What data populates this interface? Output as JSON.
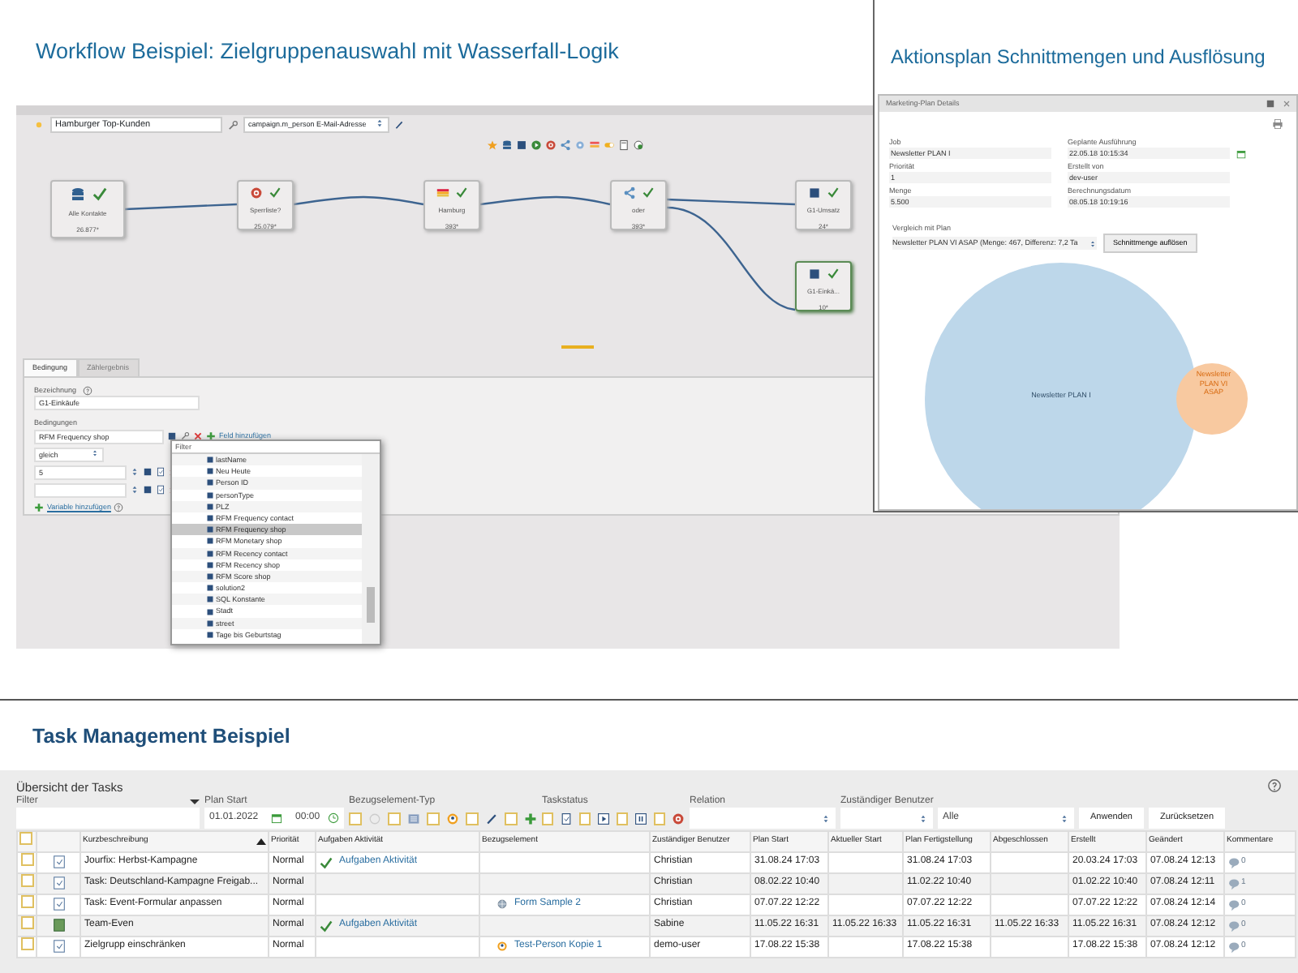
{
  "workflow": {
    "heading": "Workflow Beispiel: Zielgruppenauswahl mit Wasserfall-Logik",
    "name_field": "Hamburger Top-Kunden",
    "attribute_select": "campaign.m_person E-Mail-Adresse",
    "nodes": [
      {
        "label": "Alle Kontakte",
        "count": "26.877*",
        "kind": "database",
        "selected": false
      },
      {
        "label": "Sperrliste?",
        "count": "25.079*",
        "kind": "stop",
        "selected": false
      },
      {
        "label": "Hamburg",
        "count": "393*",
        "kind": "stripes",
        "selected": false
      },
      {
        "label": "oder",
        "count": "393*",
        "kind": "share",
        "selected": false
      },
      {
        "label": "G1-Umsatz",
        "count": "24*",
        "kind": "square",
        "selected": false
      },
      {
        "label": "G1-Einkä...",
        "count": "10*",
        "kind": "square",
        "selected": true
      }
    ],
    "tabs": [
      {
        "label": "Bedingung",
        "selected": true
      },
      {
        "label": "Zählergebnis",
        "selected": false
      }
    ],
    "form": {
      "name_label": "Bezeichnung",
      "name_value": "G1-Einkäufe",
      "conditions_label": "Bedingungen",
      "condition_field": "RFM Frequency shop",
      "add_field_link": "Feld hinzufügen",
      "operator": "gleich",
      "values": [
        {
          "kind": "filled",
          "value": "5"
        },
        {
          "kind": "blank"
        }
      ],
      "add_variable_link": "Variable hinzufügen"
    },
    "dropdown": {
      "placeholder": "Filter",
      "items": [
        {
          "label": "lastName",
          "selected": false
        },
        {
          "label": "Neu Heute",
          "selected": false
        },
        {
          "label": "Person ID",
          "selected": false
        },
        {
          "label": "personType",
          "selected": false
        },
        {
          "label": "PLZ",
          "selected": false
        },
        {
          "label": "RFM Frequency contact",
          "selected": false
        },
        {
          "label": "RFM Frequency shop",
          "selected": true
        },
        {
          "label": "RFM Monetary shop",
          "selected": false
        },
        {
          "label": "RFM Recency contact",
          "selected": false
        },
        {
          "label": "RFM Recency shop",
          "selected": false
        },
        {
          "label": "RFM Score shop",
          "selected": false
        },
        {
          "label": "solution2",
          "selected": false
        },
        {
          "label": "SQL Konstante",
          "selected": false
        },
        {
          "label": "Stadt",
          "selected": false
        },
        {
          "label": "street",
          "selected": false
        },
        {
          "label": "Tage bis Geburtstag",
          "selected": false
        }
      ]
    }
  },
  "action_plan": {
    "heading": "Aktionsplan Schnittmengen und Ausflösung",
    "window_title": "Marketing-Plan Details",
    "fields": [
      {
        "label": "Job",
        "value": "Newsletter PLAN I"
      },
      {
        "label": "Geplante Ausführung",
        "value": "22.05.18 10:15:34"
      },
      {
        "label": "Priorität",
        "value": "1"
      },
      {
        "label": "Erstellt von",
        "value": "dev-user"
      },
      {
        "label": "Menge",
        "value": "5.500"
      },
      {
        "label": "Berechnungsdatum",
        "value": "08.05.18 10:19:16"
      }
    ],
    "compare_label": "Vergleich mit Plan",
    "compare_value": "Newsletter PLAN VI ASAP (Menge: 467, Differenz: 7,2 Ta",
    "resolve_button": "Schnittmenge auflösen",
    "venn": [
      {
        "label": "Newsletter PLAN I",
        "color": "#bdd7ea"
      },
      {
        "label": "Newsletter PLAN VI ASAP",
        "color": "#f8c9a0"
      }
    ]
  },
  "tasks": {
    "heading": "Task Management Beispiel",
    "panel_title": "Übersicht der Tasks",
    "filter": {
      "filter_label": "Filter",
      "plan_start_label": "Plan Start",
      "date": "01.01.2022",
      "time": "00:00",
      "type_label": "Bezugselement-Typ",
      "type_checks": [
        {
          "kind": "circle",
          "checked": false
        },
        {
          "kind": "list",
          "checked": false
        },
        {
          "kind": "user",
          "checked": false
        },
        {
          "kind": "pen",
          "checked": false
        },
        {
          "kind": "plus",
          "checked": false
        }
      ],
      "status_label": "Taskstatus",
      "status_checks": [
        {
          "kind": "doc",
          "checked": false
        },
        {
          "kind": "play",
          "checked": false
        },
        {
          "kind": "pause",
          "checked": false
        },
        {
          "kind": "stop",
          "checked": false
        }
      ],
      "relation_label": "Relation",
      "user_label": "Zuständiger Benutzer",
      "all_select": "Alle",
      "apply_button": "Anwenden",
      "reset_button": "Zurücksetzen"
    },
    "select_all_checked": false,
    "columns": [
      "Kurzbeschreibung",
      "Priorität",
      "Aufgaben Aktivität",
      "Bezugselement",
      "Zuständiger Benutzer",
      "Plan Start",
      "Aktueller Start",
      "Plan Fertigstellung",
      "Abgeschlossen",
      "Erstellt",
      "Geändert",
      "Kommentare"
    ],
    "rows": [
      {
        "checked": false,
        "kind": "task",
        "title": "Jourfix: Herbst-Kampagne",
        "priority": "Normal",
        "activity": "Aufgaben Aktivität",
        "user": "Christian",
        "plan_start": "31.08.24 17:03",
        "plan_finish": "31.08.24 17:03",
        "created": "20.03.24 17:03",
        "changed": "07.08.24 12:13",
        "comments": "0"
      },
      {
        "checked": false,
        "kind": "task",
        "title": "Task: Deutschland-Kampagne Freigab...",
        "priority": "Normal",
        "user": "Christian",
        "plan_start": "08.02.22 10:40",
        "plan_finish": "11.02.22 10:40",
        "created": "01.02.22 10:40",
        "changed": "07.08.24 12:11",
        "comments": "1"
      },
      {
        "checked": false,
        "kind": "task",
        "title": "Task: Event-Formular anpassen",
        "priority": "Normal",
        "reference": {
          "kind": "form",
          "label": "Form Sample 2"
        },
        "user": "Christian",
        "plan_start": "07.07.22 12:22",
        "plan_finish": "07.07.22 12:22",
        "created": "07.07.22 12:22",
        "changed": "07.08.24 12:14",
        "comments": "0"
      },
      {
        "checked": false,
        "kind": "team",
        "title": "Team-Even",
        "priority": "Normal",
        "activity": "Aufgaben Aktivität",
        "user": "Sabine",
        "plan_start": "11.05.22 16:31",
        "actual_start": "11.05.22 16:33",
        "plan_finish": "11.05.22 16:31",
        "finished": "11.05.22 16:33",
        "created": "11.05.22 16:31",
        "changed": "07.08.24 12:12",
        "comments": "0"
      },
      {
        "checked": false,
        "kind": "task",
        "title": "Zielgrupp einschränken",
        "priority": "Normal",
        "reference": {
          "kind": "person",
          "label": "Test-Person Kopie 1"
        },
        "user": "demo-user",
        "plan_start": "17.08.22 15:38",
        "plan_finish": "17.08.22 15:38",
        "created": "17.08.22 15:38",
        "changed": "07.08.24 12:12",
        "comments": "0"
      }
    ]
  }
}
